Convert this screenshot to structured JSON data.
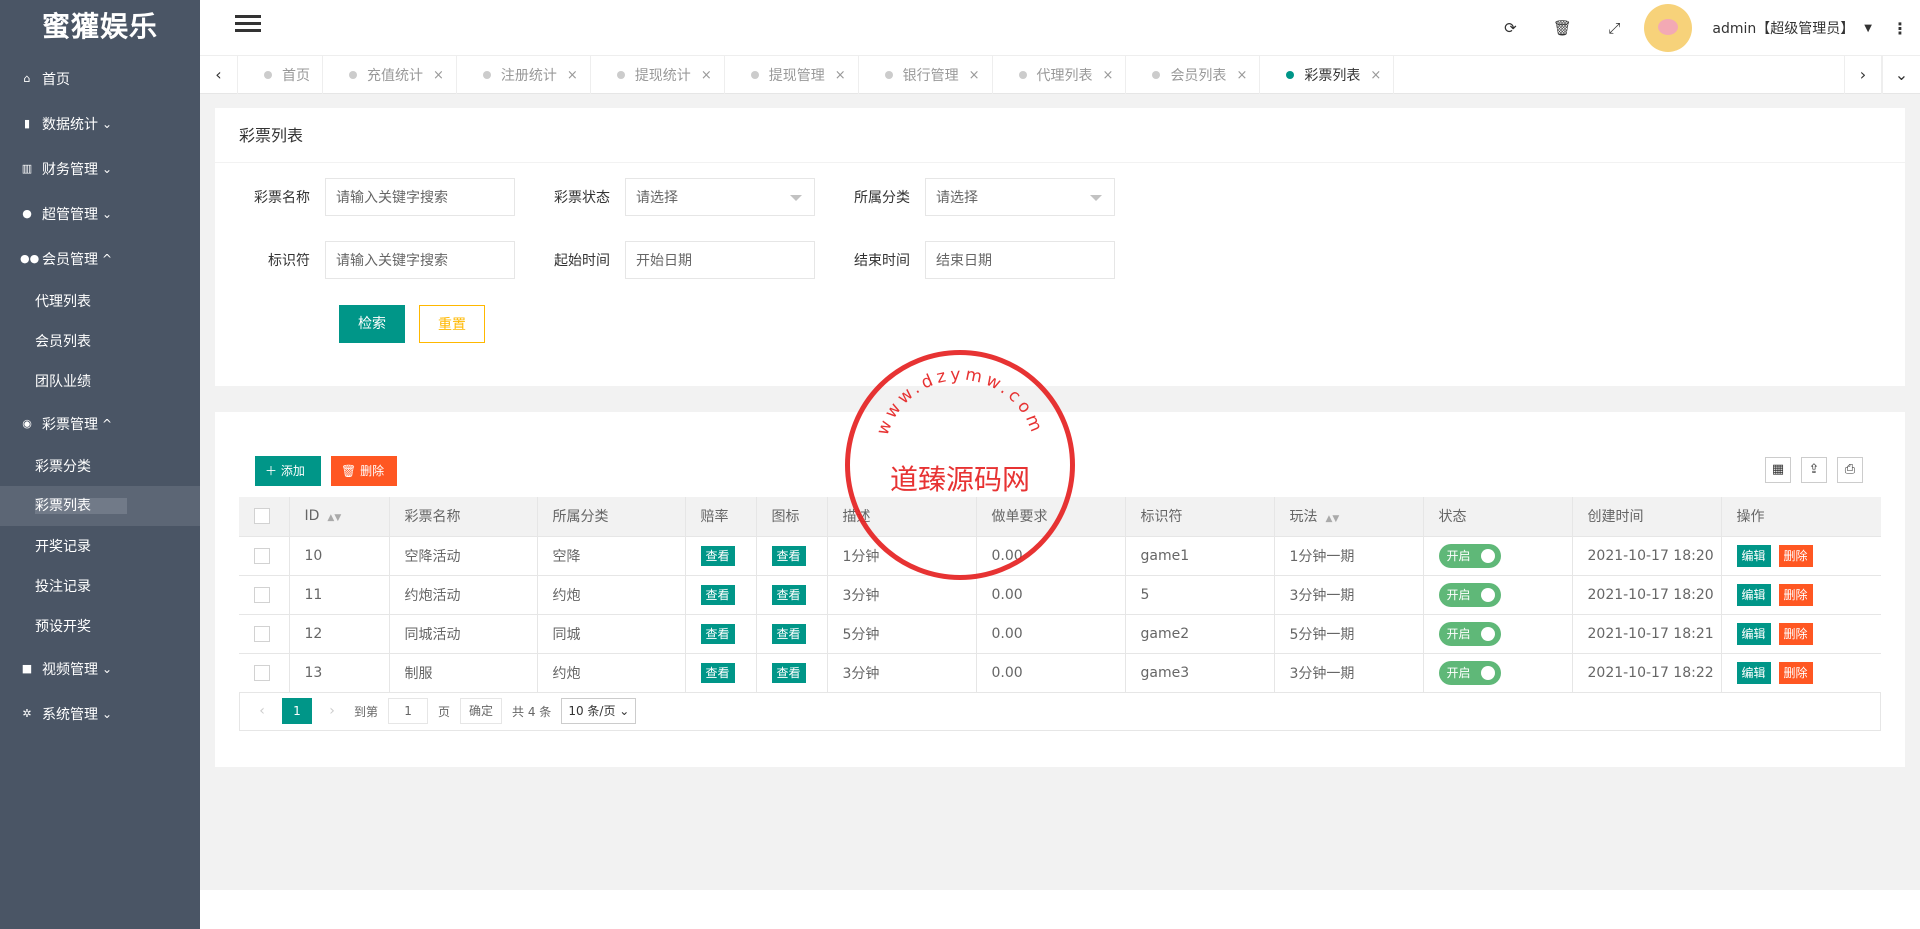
{
  "brand": "蜜獾娱乐",
  "sidebar": {
    "items": [
      {
        "icon": "home-icon",
        "label": "首页"
      },
      {
        "icon": "chart-icon",
        "label": "数据统计"
      },
      {
        "icon": "bank-icon",
        "label": "财务管理"
      },
      {
        "icon": "user-icon",
        "label": "超管管理"
      },
      {
        "icon": "users-icon",
        "label": "会员管理",
        "children": [
          "代理列表",
          "会员列表",
          "团队业绩"
        ]
      },
      {
        "icon": "gamepad-icon",
        "label": "彩票管理",
        "children": [
          "彩票分类",
          "彩票列表",
          "开奖记录",
          "投注记录",
          "预设开奖"
        ]
      },
      {
        "icon": "video-icon",
        "label": "视频管理"
      },
      {
        "icon": "gear-icon",
        "label": "系统管理"
      }
    ]
  },
  "topbar": {
    "user": "admin【超级管理员】"
  },
  "tabs": [
    "首页",
    "充值统计",
    "注册统计",
    "提现统计",
    "提现管理",
    "银行管理",
    "代理列表",
    "会员列表",
    "彩票列表"
  ],
  "filter": {
    "title": "彩票列表",
    "fields": [
      {
        "label": "彩票名称",
        "placeholder": "请输入关键字搜索"
      },
      {
        "label": "彩票状态",
        "placeholder": "请选择"
      },
      {
        "label": "所属分类",
        "placeholder": "请选择"
      },
      {
        "label": "标识符",
        "placeholder": "请输入关键字搜索"
      },
      {
        "label": "起始时间",
        "placeholder": "开始日期"
      },
      {
        "label": "结束时间",
        "placeholder": "结束日期"
      }
    ],
    "search_label": "检索",
    "reset_label": "重置"
  },
  "toolbar": {
    "add_label": "添加",
    "delete_label": "删除"
  },
  "table": {
    "headers": [
      "ID",
      "彩票名称",
      "所属分类",
      "赔率",
      "图标",
      "描述",
      "做单要求",
      "标识符",
      "玩法",
      "状态",
      "创建时间",
      "操作"
    ],
    "view_label": "查看",
    "status_label": "开启",
    "edit_label": "编辑",
    "delete_label": "删除",
    "rows": [
      {
        "id": "10",
        "name": "空降活动",
        "category": "空降",
        "desc": "1分钟",
        "req": "0.00",
        "code": "game1",
        "play": "1分钟一期",
        "created": "2021-10-17 18:20"
      },
      {
        "id": "11",
        "name": "约炮活动",
        "category": "约炮",
        "desc": "3分钟",
        "req": "0.00",
        "code": "5",
        "play": "3分钟一期",
        "created": "2021-10-17 18:20"
      },
      {
        "id": "12",
        "name": "同城活动",
        "category": "同城",
        "desc": "5分钟",
        "req": "0.00",
        "code": "game2",
        "play": "5分钟一期",
        "created": "2021-10-17 18:21"
      },
      {
        "id": "13",
        "name": "制服",
        "category": "约炮",
        "desc": "3分钟",
        "req": "0.00",
        "code": "game3",
        "play": "3分钟一期",
        "created": "2021-10-17 18:22"
      }
    ]
  },
  "pager": {
    "current": "1",
    "goto_label": "到第",
    "page_value": "1",
    "page_label": "页",
    "ok_label": "确定",
    "total": "共 4 条",
    "size": "10 条/页"
  },
  "watermark": {
    "ring_text": "www.dzymw.com",
    "center": "道臻源码网"
  }
}
